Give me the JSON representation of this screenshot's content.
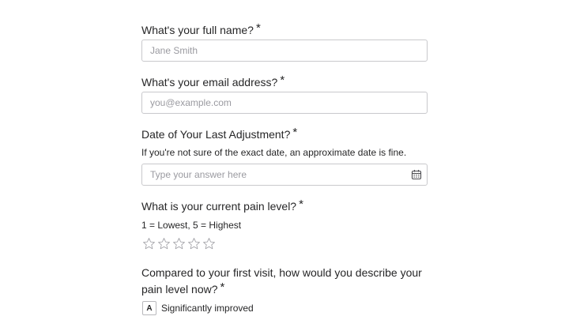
{
  "questions": {
    "full_name": {
      "label": "What's your full name?",
      "required_mark": "*",
      "placeholder": "Jane Smith",
      "value": ""
    },
    "email": {
      "label": "What's your email address?",
      "required_mark": "*",
      "placeholder": "you@example.com",
      "value": ""
    },
    "last_adjustment": {
      "label": "Date of Your Last Adjustment?",
      "required_mark": "*",
      "help": "If you're not sure of the exact date, an approximate date is fine.",
      "placeholder": "Type your answer here",
      "value": "",
      "icon": "calendar-icon"
    },
    "pain_level": {
      "label": "What is your current pain level?",
      "required_mark": "*",
      "help": "1 = Lowest, 5 = Highest",
      "max_rating": 5,
      "rating": 0,
      "icon": "star-outline-icon"
    },
    "comparison": {
      "label": "Compared to your first visit, how would you describe your pain level now?",
      "required_mark": "*",
      "options": [
        {
          "key": "A",
          "label": "Significantly improved"
        }
      ]
    }
  }
}
